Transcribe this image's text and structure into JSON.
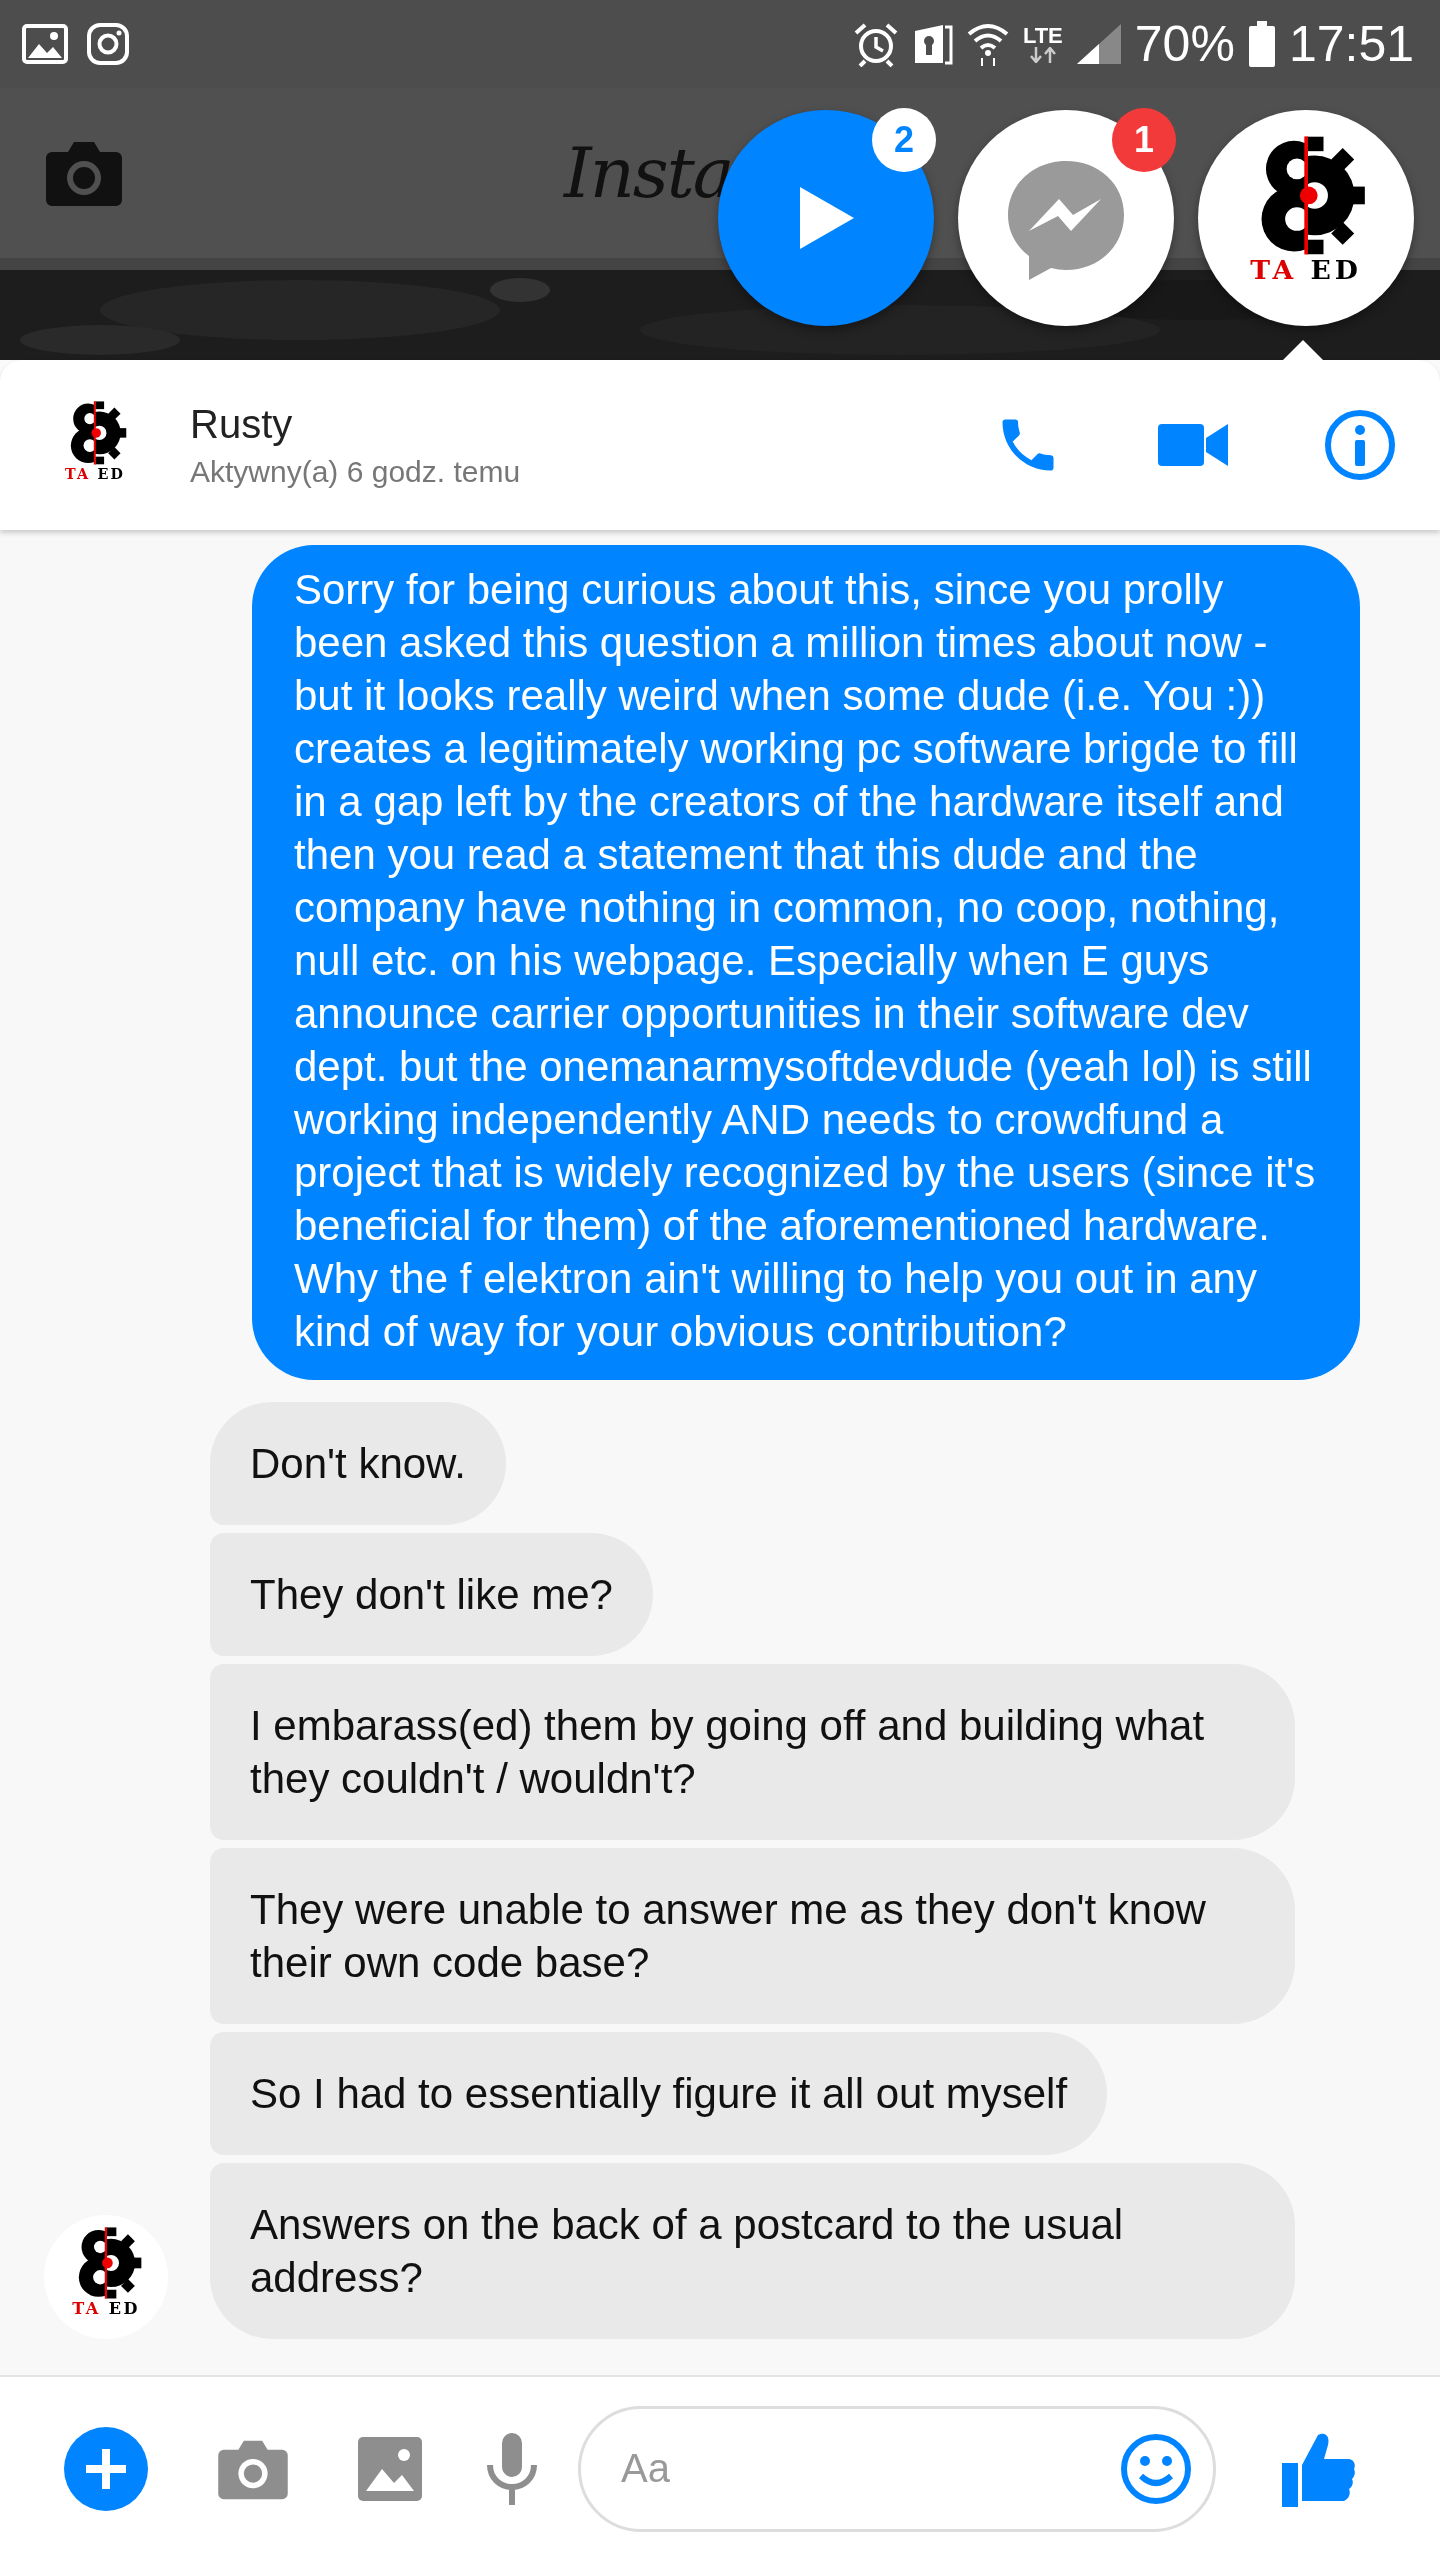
{
  "status_bar": {
    "network": "LTE",
    "battery": "70%",
    "time": "17:51"
  },
  "background_app": {
    "title": "Insta"
  },
  "chat_heads": [
    {
      "kind": "play",
      "badge": "2"
    },
    {
      "kind": "messenger",
      "badge": "1"
    },
    {
      "kind": "avatar",
      "caption_red": "TA",
      "caption": "ED"
    }
  ],
  "conversation": {
    "name": "Rusty",
    "status": "Aktywny(a) 6 godz. temu",
    "avatar": {
      "caption_red": "TA",
      "caption": "ED"
    }
  },
  "messages": [
    {
      "kind": "sent",
      "text": "Sorry for being curious about this, since you prolly been asked this question a million times about now - but it looks really weird when some dude (i.e. You :)) creates a legitimately working pc software brigde to fill in a gap left by the creators of the hardware itself and then you read a statement that this dude and the company have nothing in common, no coop, nothing, null etc. on his webpage. Especially when E guys announce carrier opportunities in their software dev dept. but the onemanarmysoftdevdude (yeah lol) is still working independently AND needs to crowdfund a project that is widely recognized by the users (since it's beneficial for them) of the aforementioned hardware. Why the f elektron ain't willing to help you out in any kind of way for your obvious contribution?"
    },
    {
      "kind": "received",
      "text": "Don't know."
    },
    {
      "kind": "received",
      "text": "They don't like me?"
    },
    {
      "kind": "received",
      "text": "I embarass(ed) them by going off and building what they couldn't / wouldn't?"
    },
    {
      "kind": "received",
      "text": "They were unable to answer me as they don't know their own code base?"
    },
    {
      "kind": "received",
      "text": "So I had to essentially figure it all out myself"
    },
    {
      "kind": "received",
      "text": "Answers on the back of a postcard to the usual address?"
    }
  ],
  "sender_avatar": {
    "caption_red": "TA",
    "caption": "ED"
  },
  "composer": {
    "placeholder": "Aa"
  }
}
